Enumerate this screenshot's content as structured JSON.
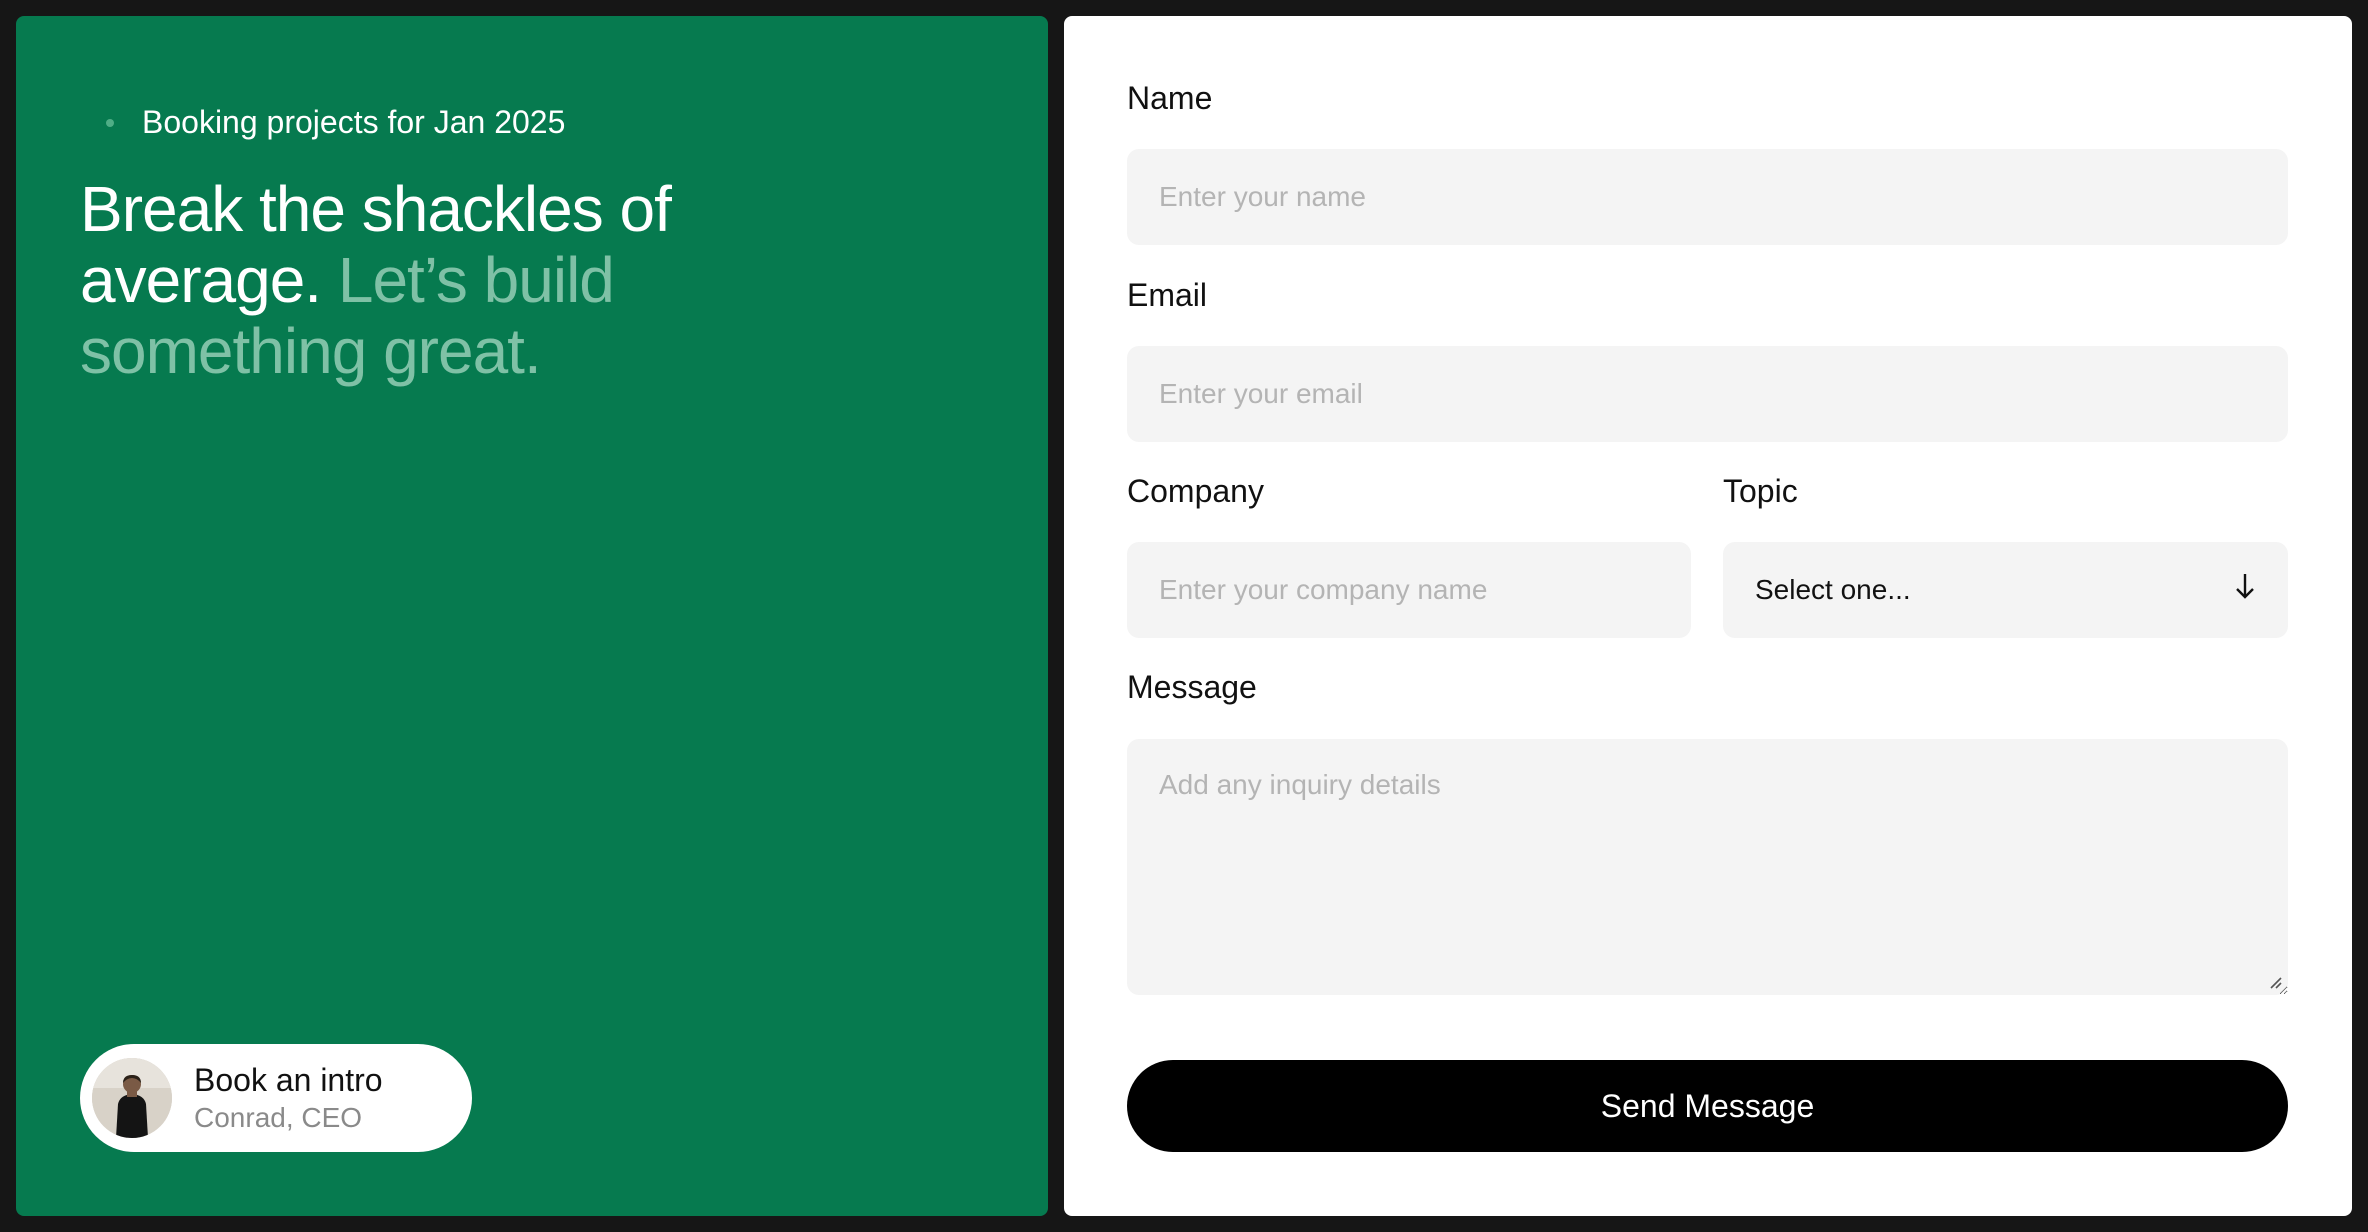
{
  "hero": {
    "availability": "Booking projects for Jan 2025",
    "headline_strong": "Break the shackles of average.",
    "headline_muted": "Let’s build something great."
  },
  "intro": {
    "title": "Book an intro",
    "subtitle": "Conrad, CEO"
  },
  "form": {
    "name_label": "Name",
    "name_placeholder": "Enter your name",
    "email_label": "Email",
    "email_placeholder": "Enter your email",
    "company_label": "Company",
    "company_placeholder": "Enter your company name",
    "topic_label": "Topic",
    "topic_value": "Select one...",
    "message_label": "Message",
    "message_placeholder": "Add any inquiry details",
    "submit_label": "Send Message"
  },
  "colors": {
    "brand_green": "#067a4f",
    "muted_green_text": "#7fc1a6",
    "field_bg": "#f4f4f4",
    "button_bg": "#000000"
  },
  "icons": {
    "availability_dot": "status-dot-icon",
    "topic_arrow": "arrow-down-icon",
    "textarea_grip": "resize-handle-icon"
  }
}
